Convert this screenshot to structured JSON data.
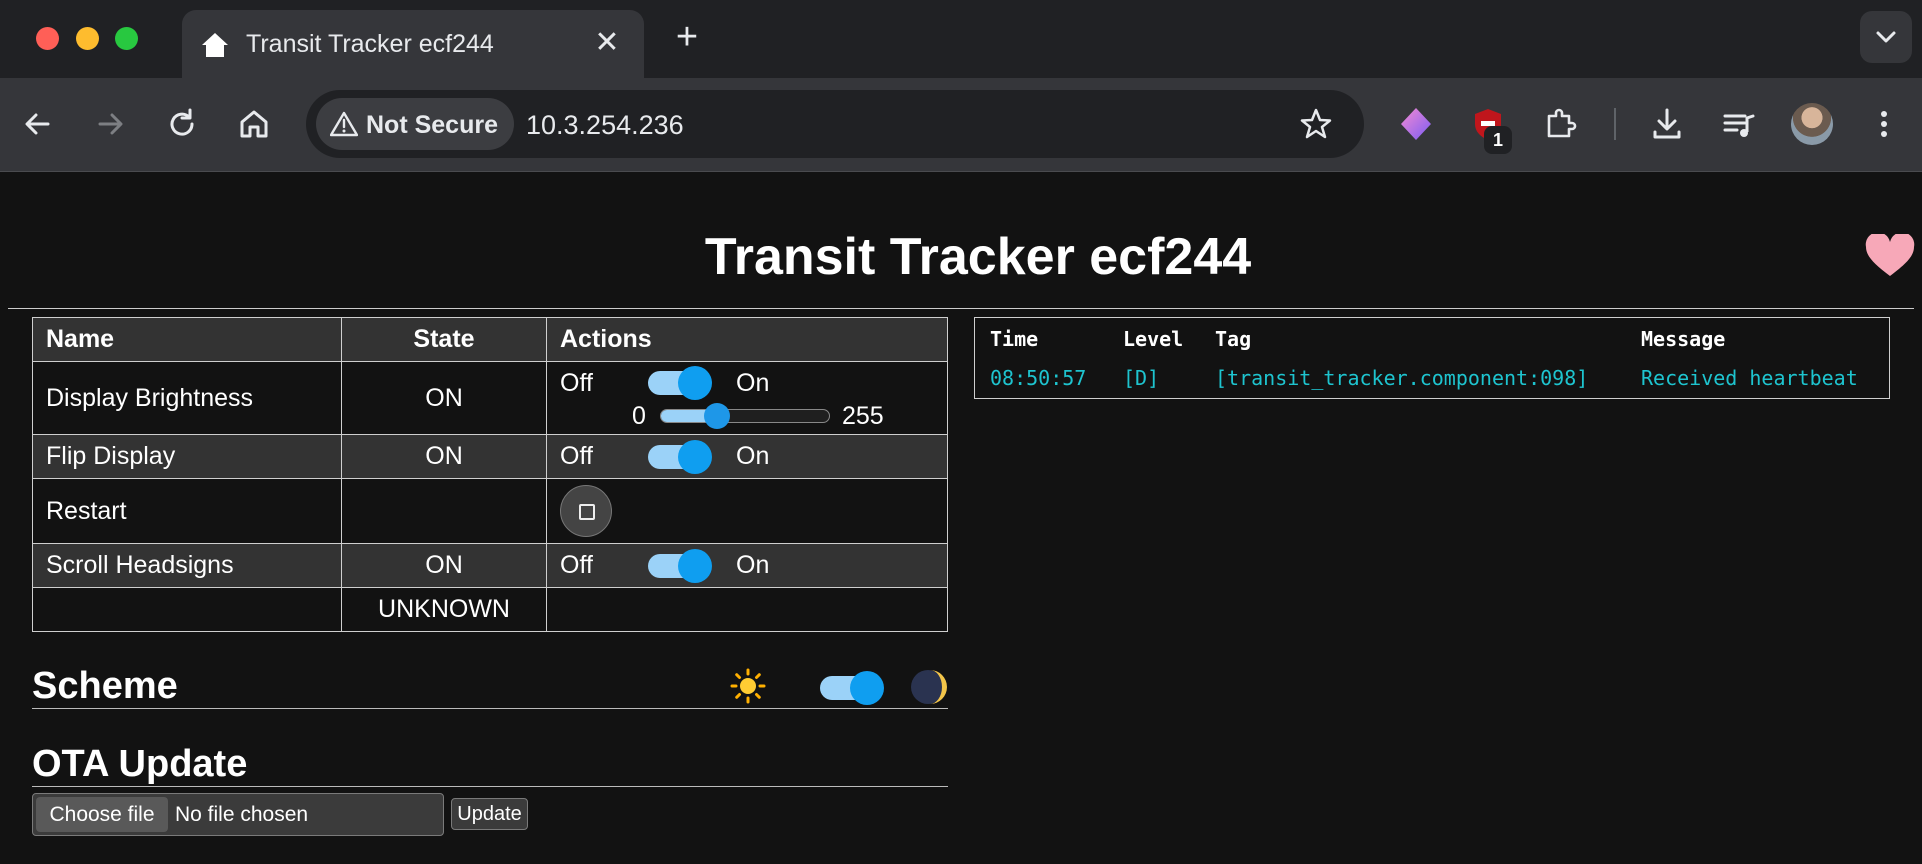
{
  "browser": {
    "tab_title": "Transit Tracker ecf244",
    "close_glyph": "✕",
    "new_tab_glyph": "+",
    "security_label": "Not Secure",
    "url": "10.3.254.236",
    "extension_badge": "1"
  },
  "page": {
    "title": "Transit Tracker ecf244",
    "table": {
      "headers": {
        "name": "Name",
        "state": "State",
        "actions": "Actions"
      },
      "rows": [
        {
          "name": "Display Brightness",
          "state": "ON",
          "off": "Off",
          "on": "On",
          "slider_min": "0",
          "slider_max": "255",
          "slider_value": 85
        },
        {
          "name": "Flip Display",
          "state": "ON",
          "off": "Off",
          "on": "On"
        },
        {
          "name": "Restart",
          "state": ""
        },
        {
          "name": "Scroll Headsigns",
          "state": "ON",
          "off": "Off",
          "on": "On"
        },
        {
          "name": "",
          "state": "UNKNOWN"
        }
      ]
    },
    "scheme": {
      "title": "Scheme",
      "sun_icon": "☀",
      "moon_icon": "🌒",
      "dark_enabled": true
    },
    "ota": {
      "title": "OTA Update",
      "choose_label": "Choose file",
      "file_status": "No file chosen",
      "update_label": "Update"
    },
    "log": {
      "headers": {
        "time": "Time",
        "level": "Level",
        "tag": "Tag",
        "message": "Message"
      },
      "entries": [
        {
          "time": "08:50:57",
          "level": "[D]",
          "tag": "[transit_tracker.component:098]",
          "message": "Received heartbeat"
        }
      ]
    }
  },
  "colors": {
    "accent": "#0f9ef0",
    "log_text": "#1ec4cf",
    "heart": "#f7a8b8"
  }
}
